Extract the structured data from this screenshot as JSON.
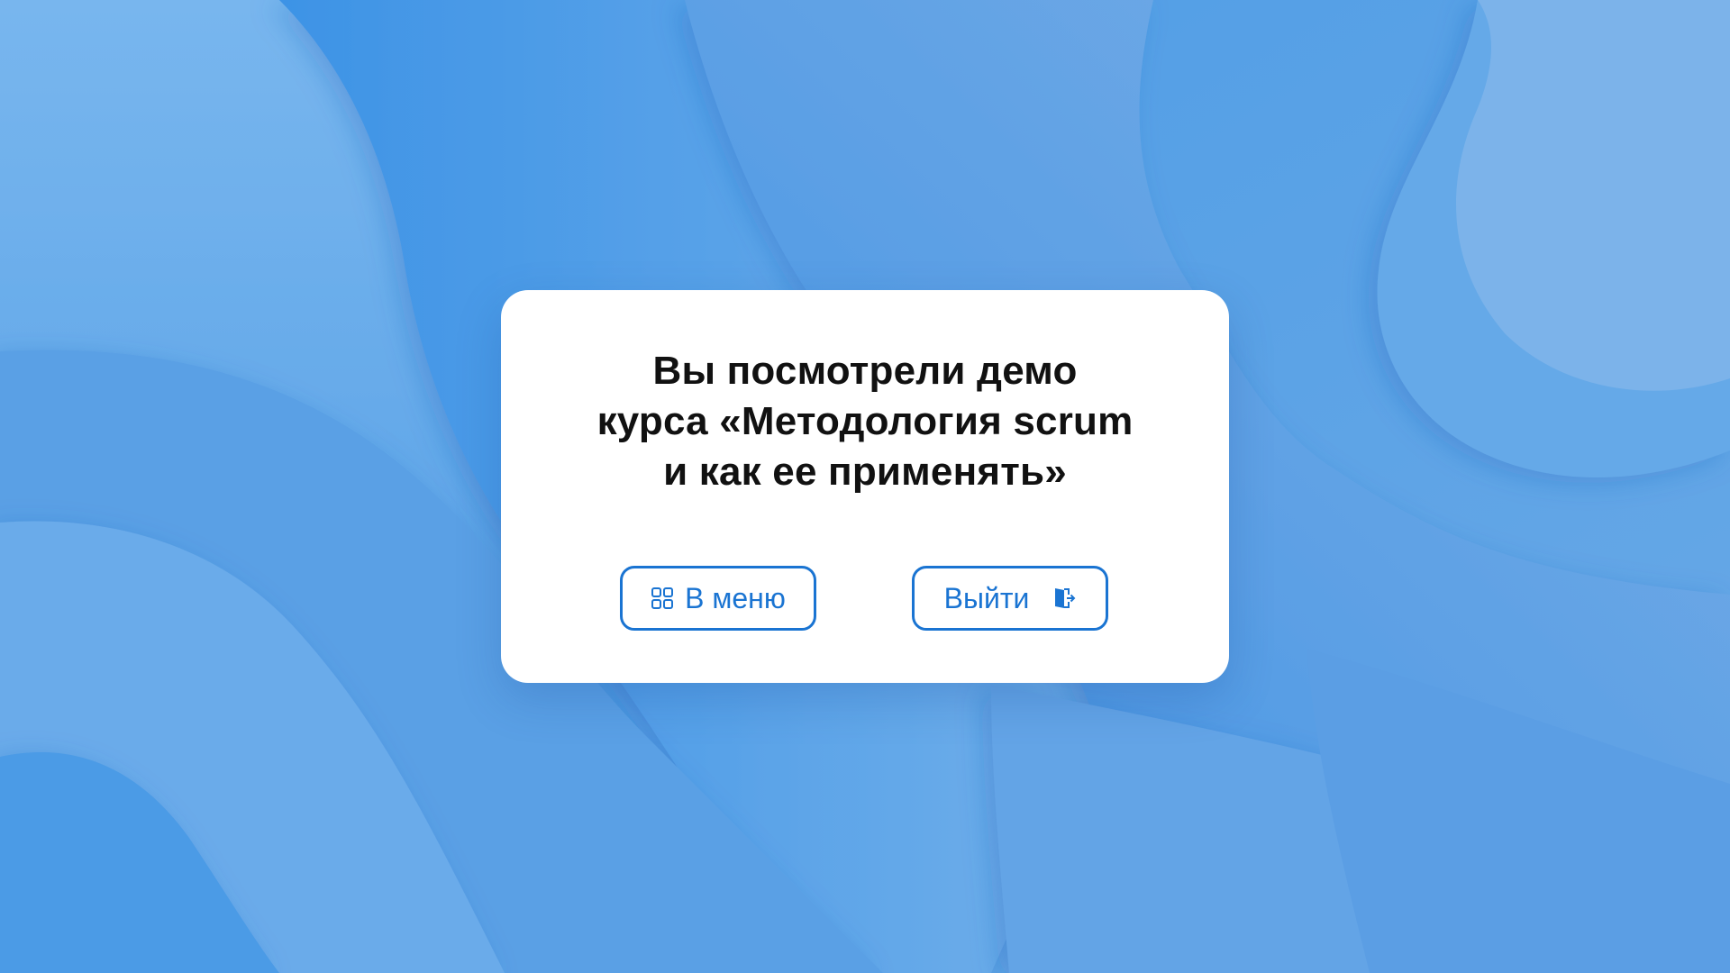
{
  "dialog": {
    "message_lines": [
      "Вы посмотрели демо",
      "курса «Методология scrum",
      "и как ее применять»"
    ],
    "menu_button": {
      "label": "В меню",
      "icon": "grid-icon"
    },
    "exit_button": {
      "label": "Выйти",
      "icon": "exit-door-icon"
    }
  },
  "colors": {
    "accent": "#1a74d2",
    "background": "#5fa6e6",
    "dialog_bg": "#ffffff",
    "text": "#111111"
  }
}
